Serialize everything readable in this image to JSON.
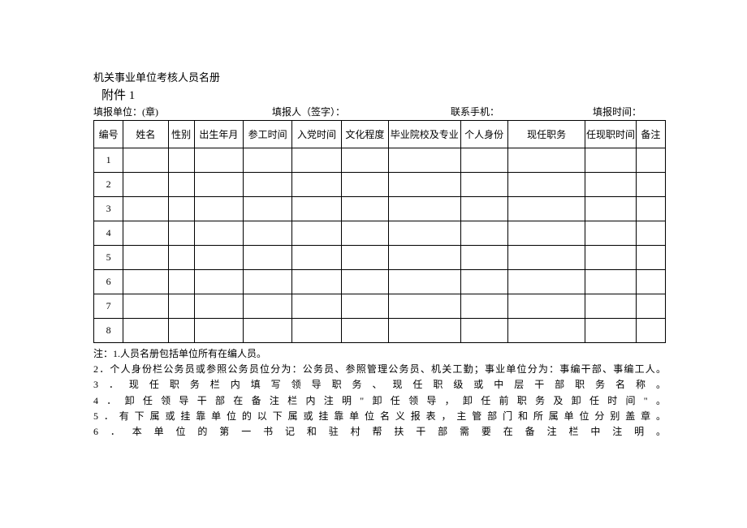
{
  "doc_title": "机关事业单位考核人员名册",
  "attachment_label": "附件 1",
  "meta": {
    "unit": "填报单位：(章)",
    "reporter": "填报人（签字）：",
    "phone": "联系手机：",
    "time": "填报时间："
  },
  "table": {
    "headers": [
      "编号",
      "姓名",
      "性别",
      "出生年月",
      "参工时间",
      "入党时间",
      "文化程度",
      "毕业院校及专业",
      "个人身份",
      "现任职务",
      "任现职时间",
      "备注"
    ],
    "rows": [
      {
        "no": "1"
      },
      {
        "no": "2"
      },
      {
        "no": "3"
      },
      {
        "no": "4"
      },
      {
        "no": "5"
      },
      {
        "no": "6"
      },
      {
        "no": "7"
      },
      {
        "no": "8"
      }
    ]
  },
  "notes": {
    "n1": "注：1.人员名册包括单位所有在编人员。",
    "n2": "2．个人身份栏公务员或参照公务员位分为：公务员、参照管理公务员、机关工勤；事业单位分为：事编干部、事编工人。",
    "n3": "3．现任职务栏内填写领导职务、现任职级或中层干部职务名称。",
    "n4": "4．卸任领导干部在备注栏内注明\"卸任领导，卸任前职务及卸任时间\"。",
    "n5": "5．有下属或挂靠单位的以下属或挂靠单位名义报表，主管部门和所属单位分别盖章。",
    "n6": "6．本单位的第一书记和驻村帮扶干部需要在备注栏中注明。"
  }
}
